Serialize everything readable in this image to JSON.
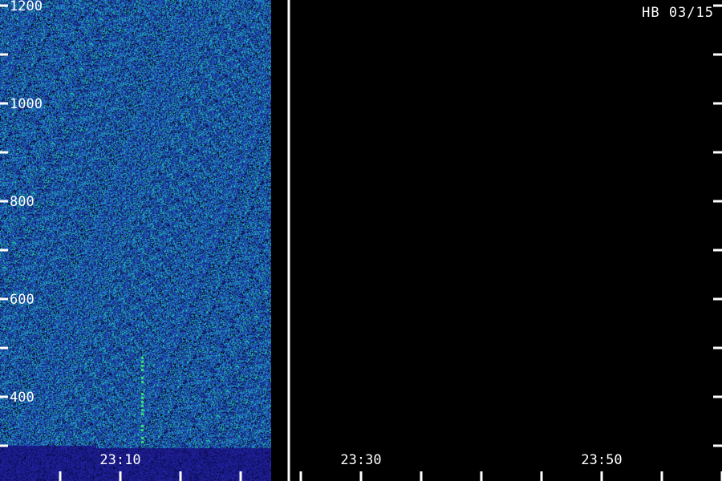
{
  "header": {
    "station_label": "HB 03/15"
  },
  "colors": {
    "background": "#000000",
    "axis": "#ffffff",
    "noise_low": "#1a2f9a",
    "noise_mid": "#1f6fc0",
    "noise_high": "#22c8a8",
    "signal": "#3cf07a",
    "floor": "#1a1a8a"
  },
  "chart_data": {
    "type": "heatmap",
    "title": "",
    "xlabel": "",
    "ylabel": "",
    "x_ticks": [
      "23:10",
      "23:30",
      "23:50"
    ],
    "y_ticks": [
      "400",
      "600",
      "800",
      "1000",
      "1200"
    ],
    "ylim": [
      300,
      1200
    ],
    "series": [
      {
        "name": "",
        "x_start": "23:03",
        "x_end": "23:16"
      }
    ],
    "grid": false
  }
}
